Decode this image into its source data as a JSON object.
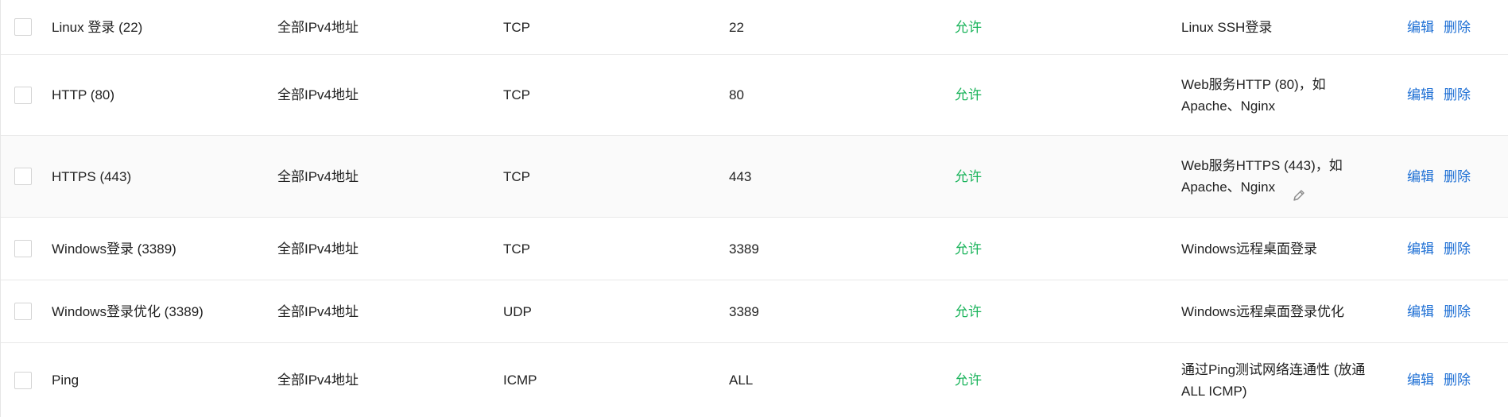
{
  "rows": [
    {
      "name": "Linux 登录 (22)",
      "source": "全部IPv4地址",
      "protocol": "TCP",
      "port": "22",
      "policy": "允许",
      "remark": "Linux SSH登录",
      "edit": "编辑",
      "delete": "删除"
    },
    {
      "name": "HTTP (80)",
      "source": "全部IPv4地址",
      "protocol": "TCP",
      "port": "80",
      "policy": "允许",
      "remark": "Web服务HTTP (80)，如\nApache、Nginx",
      "edit": "编辑",
      "delete": "删除"
    },
    {
      "name": "HTTPS (443)",
      "source": "全部IPv4地址",
      "protocol": "TCP",
      "port": "443",
      "policy": "允许",
      "remark": "Web服务HTTPS (443)，如\nApache、Nginx",
      "edit": "编辑",
      "delete": "删除"
    },
    {
      "name": "Windows登录 (3389)",
      "source": "全部IPv4地址",
      "protocol": "TCP",
      "port": "3389",
      "policy": "允许",
      "remark": "Windows远程桌面登录",
      "edit": "编辑",
      "delete": "删除"
    },
    {
      "name": "Windows登录优化 (3389)",
      "source": "全部IPv4地址",
      "protocol": "UDP",
      "port": "3389",
      "policy": "允许",
      "remark": "Windows远程桌面登录优化",
      "edit": "编辑",
      "delete": "删除"
    },
    {
      "name": "Ping",
      "source": "全部IPv4地址",
      "protocol": "ICMP",
      "port": "ALL",
      "policy": "允许",
      "remark": "通过Ping测试网络连通性 (放通\nALL ICMP)",
      "edit": "编辑",
      "delete": "删除"
    }
  ],
  "colors": {
    "policy_allow": "#19b35a",
    "link": "#1c6ed4"
  },
  "icons": {
    "remark_edit": "pencil-icon"
  }
}
